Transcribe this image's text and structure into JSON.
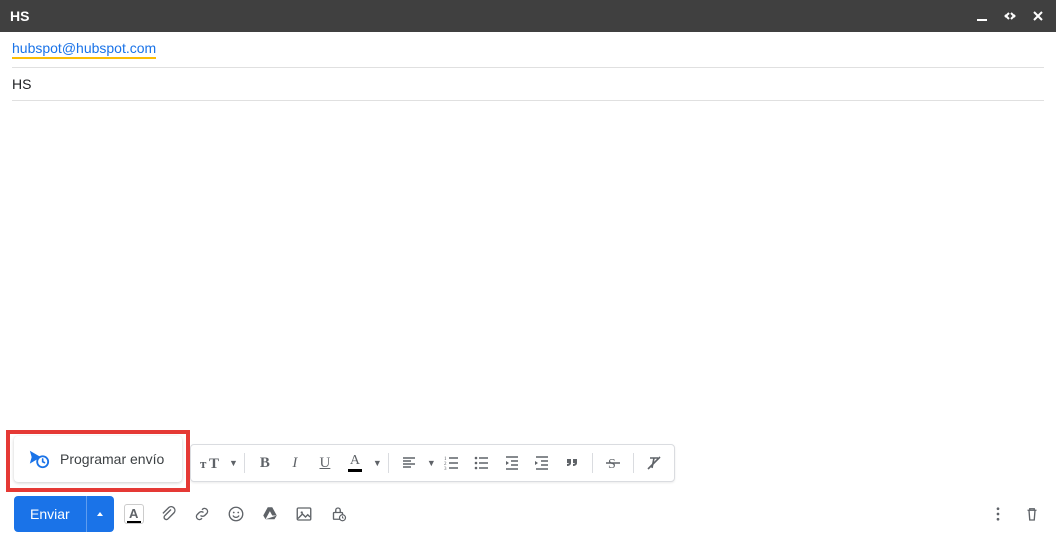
{
  "titlebar": {
    "title": "HS"
  },
  "to": {
    "address": "hubspot@hubspot.com"
  },
  "subject": {
    "text": "HS"
  },
  "schedule": {
    "label": "Programar envío"
  },
  "send": {
    "label": "Enviar"
  },
  "format": {
    "size": "TextSize",
    "bold": "B",
    "italic": "I",
    "underline": "U",
    "textcolor": "A"
  }
}
